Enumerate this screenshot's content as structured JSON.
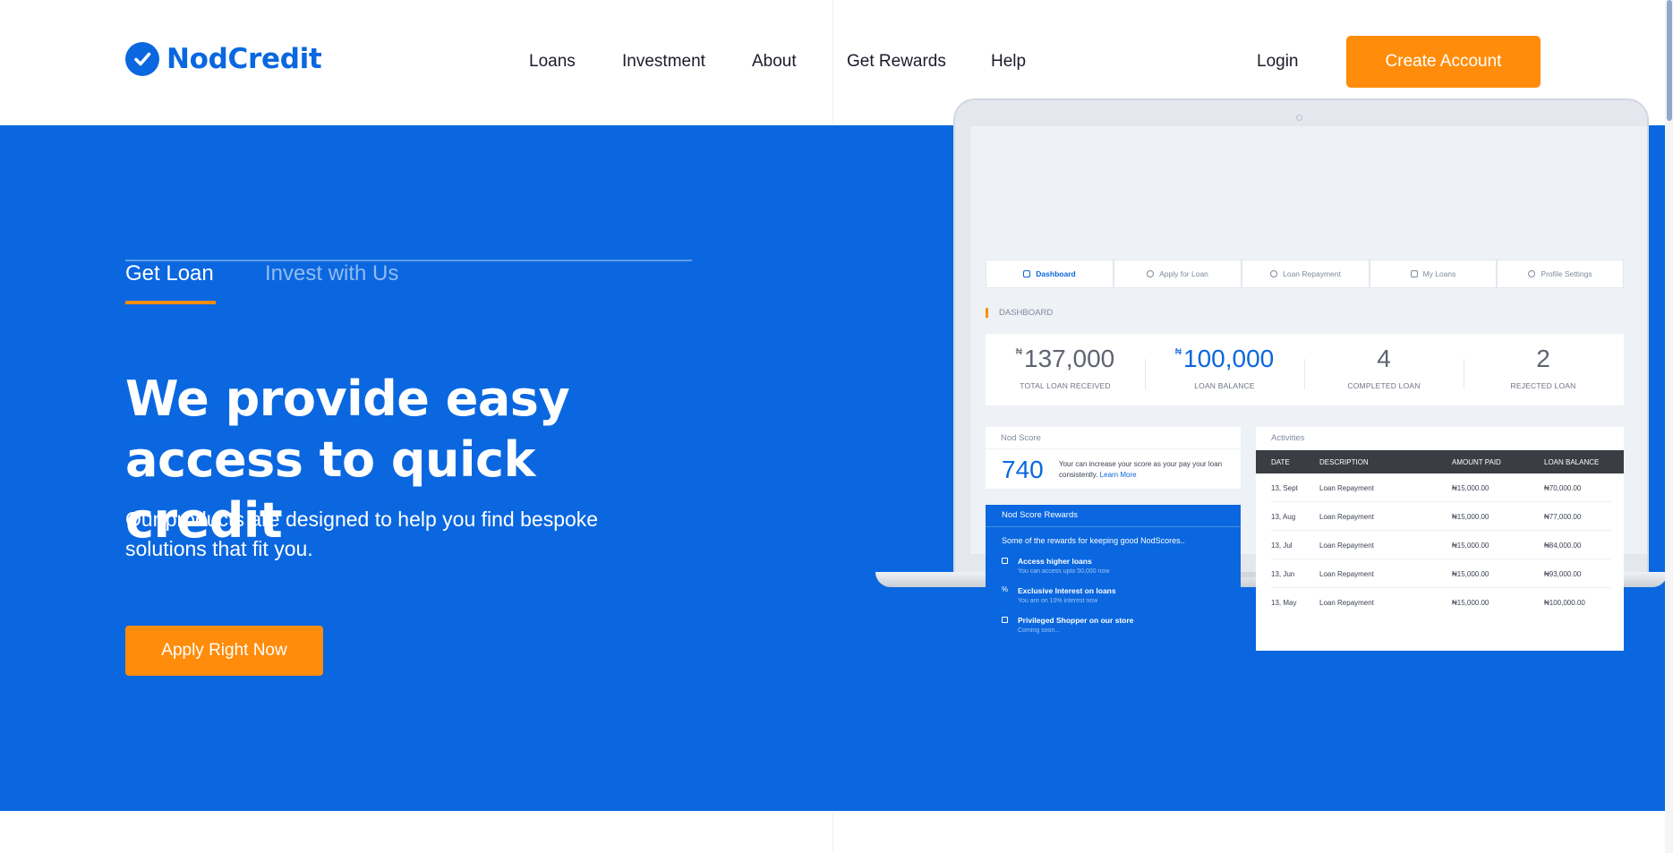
{
  "brand": {
    "name": "NodCredit"
  },
  "nav": {
    "items": [
      "Loans",
      "Investment",
      "About",
      "Get Rewards",
      "Help"
    ]
  },
  "header": {
    "login": "Login",
    "create_account": "Create Account"
  },
  "hero": {
    "tabs": [
      "Get Loan",
      "Invest with Us"
    ],
    "title": "We provide easy access to quick credit",
    "subtitle": "Our products are designed to help you find bespoke solutions that fit you.",
    "cta": "Apply Right Now"
  },
  "dashboard": {
    "tabs": [
      "Dashboard",
      "Apply for Loan",
      "Loan Repayment",
      "My Loans",
      "Profile Settings"
    ],
    "section_label": "DASHBOARD",
    "currency": "₦",
    "stats": [
      {
        "value": "137,000",
        "label": "TOTAL LOAN RECEIVED",
        "currency": true
      },
      {
        "value": "100,000",
        "label": "LOAN BALANCE",
        "currency": true
      },
      {
        "value": "4",
        "label": "COMPLETED LOAN",
        "currency": false
      },
      {
        "value": "2",
        "label": "REJECTED LOAN",
        "currency": false
      }
    ],
    "score": {
      "heading": "Nod Score",
      "value": "740",
      "text": "Your can increase your score as your pay your loan consistently.",
      "link": "Learn More"
    },
    "rewards": {
      "heading": "Nod Score Rewards",
      "intro": "Some of the rewards for keeping good NodScores..",
      "items": [
        {
          "title": "Access higher loans",
          "subtitle": "You can access upto 50,000 now"
        },
        {
          "title": "Exclusive Interest on loans",
          "subtitle": "You are on 10% interest now"
        },
        {
          "title": "Privileged Shopper on our store",
          "subtitle": "Coming soon..."
        }
      ]
    },
    "activities": {
      "heading": "Activities",
      "columns": [
        "DATE",
        "DESCRIPTION",
        "AMOUNT PAID",
        "LOAN BALANCE"
      ],
      "rows": [
        [
          "13, Sept",
          "Loan Repayment",
          "₦15,000.00",
          "₦70,000.00"
        ],
        [
          "13, Aug",
          "Loan Repayment",
          "₦15,000.00",
          "₦77,000.00"
        ],
        [
          "13, Jul",
          "Loan Repayment",
          "₦15,000.00",
          "₦84,000.00"
        ],
        [
          "13, Jun",
          "Loan Repayment",
          "₦15,000.00",
          "₦93,000.00"
        ],
        [
          "13, May",
          "Loan Repayment",
          "₦15,000.00",
          "₦100,000.00"
        ]
      ]
    }
  },
  "colors": {
    "primary": "#0a67e0",
    "accent": "#ff8c0a",
    "dark": "#1b1b2c"
  }
}
